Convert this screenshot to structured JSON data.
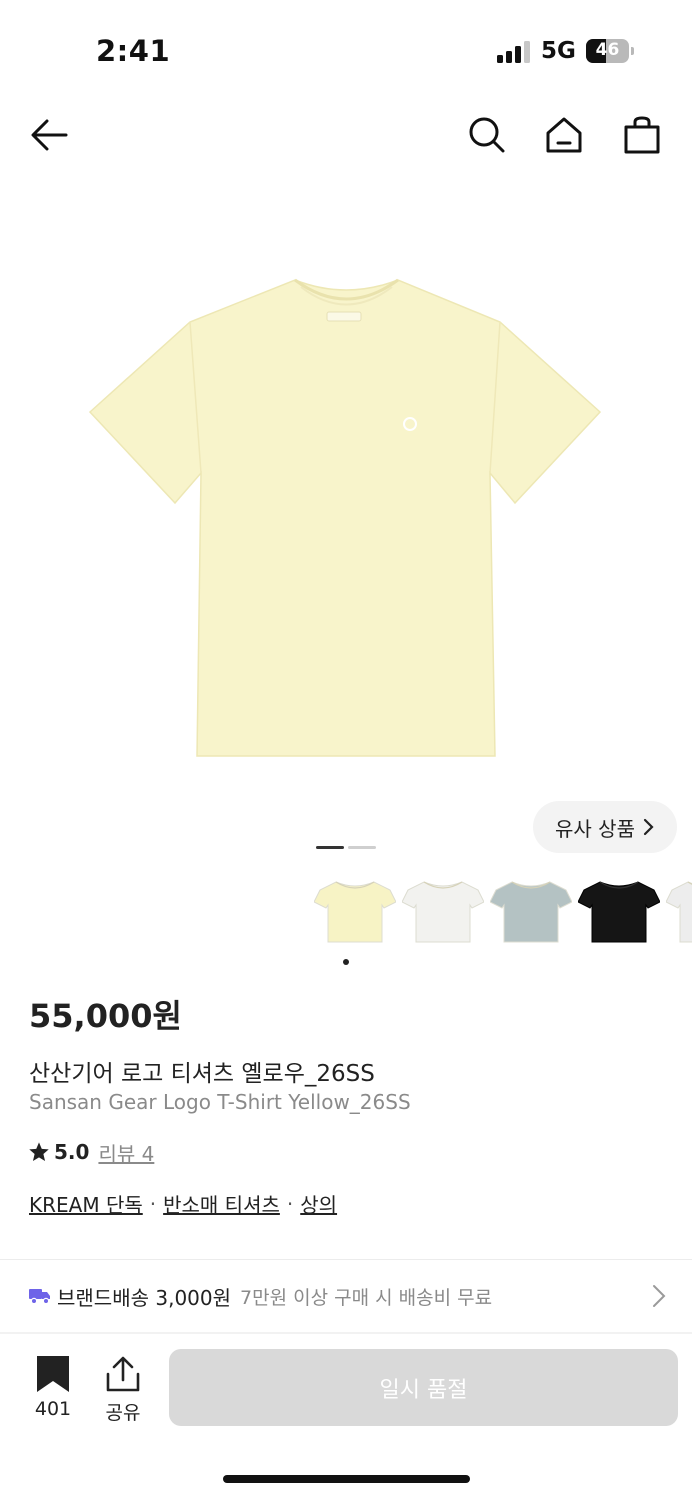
{
  "status_bar": {
    "time": "2:41",
    "network": "5G",
    "battery": "46",
    "battery_level": 0.46,
    "signal_bars": 3
  },
  "nav": {
    "back_icon": "arrow-left-icon",
    "search_icon": "search-icon",
    "home_icon": "home-icon",
    "cart_icon": "shopping-bag-icon"
  },
  "gallery": {
    "similar_label": "유사 상품",
    "current_page": 1,
    "total_pages": 2,
    "thumbnail_colors": [
      "#f7f3c5",
      "#f2f2ef",
      "#b4c2c3",
      "#151515",
      "#ededed"
    ],
    "active_thumbnail": 1
  },
  "product": {
    "price": "55,000원",
    "name_ko": "산산기어 로고 티셔츠 옐로우_26SS",
    "name_en": "Sansan Gear Logo T-Shirt Yellow_26SS",
    "rating": "5.0",
    "review_label": "리뷰 4",
    "categories": [
      "KREAM 단독",
      "반소매 티셔츠",
      "상의"
    ],
    "category_separator": "·"
  },
  "shipping": {
    "label": "브랜드배송 3,000원",
    "note": "7만원 이상 구매 시 배송비 무료",
    "icon_color": "#6e63e8"
  },
  "bottom_bar": {
    "bookmark_count": "401",
    "share_label": "공유",
    "buy_button_label": "일시 품절"
  },
  "colors": {
    "shirt": "#f8f4cb",
    "text_primary": "#222222",
    "text_secondary": "#8a8a8a",
    "disabled_button": "#d9d9d9"
  }
}
